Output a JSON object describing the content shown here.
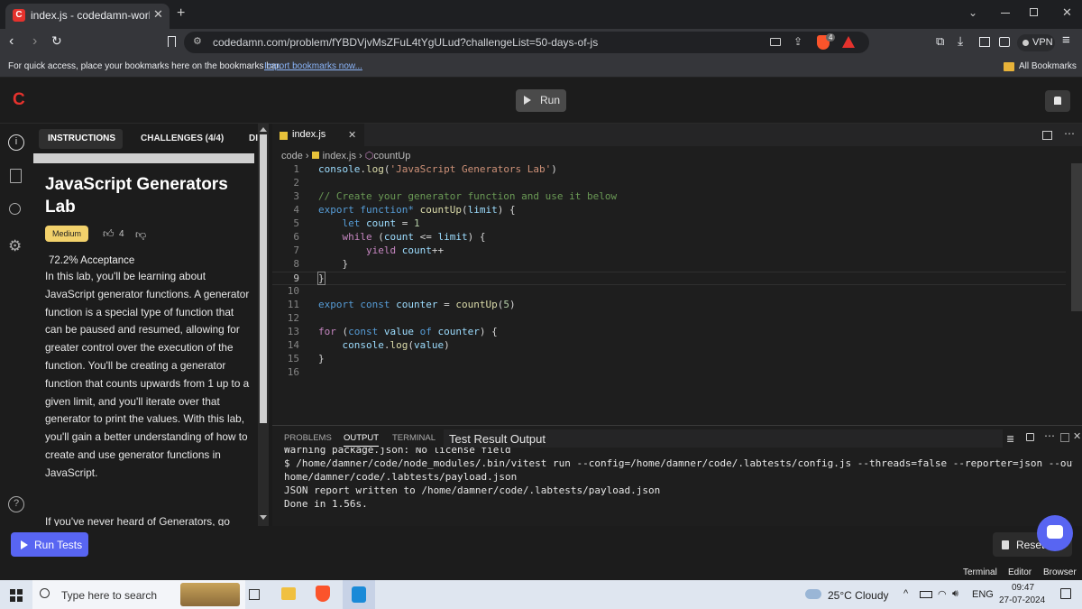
{
  "browser": {
    "tab_title": "index.js - codedamn-workspace",
    "url": "codedamn.com/problem/fYBDVjvMsZFuL4tYgULud?challengeList=50-days-of-js",
    "vpn_label": "VPN",
    "bookmarks_hint": "For quick access, place your bookmarks here on the bookmarks bar.",
    "import_link": "Import bookmarks now...",
    "all_bookmarks": "All Bookmarks",
    "brave_badge": "4"
  },
  "app": {
    "logo": "C",
    "run_label": "Run"
  },
  "instructions": {
    "tabs": [
      "INSTRUCTIONS",
      "CHALLENGES (4/4)",
      "DI"
    ],
    "title": "JavaScript Generators Lab",
    "difficulty": "Medium",
    "likes": "4",
    "acceptance": "72.2% Acceptance",
    "body": "In this lab, you'll be learning about JavaScript generator functions. A generator function is a special type of function that can be paused and resumed, allowing for greater control over the execution of the function. You'll be creating a generator function that counts upwards from 1 up to a given limit, and you'll iterate over that generator to print the values. With this lab, you'll gain a better understanding of how to create and use generator functions in JavaScript.",
    "body2": "If you've never heard of Generators, go"
  },
  "editor": {
    "tab_name": "index.js",
    "breadcrumb": [
      "code",
      "index.js",
      "countUp"
    ]
  },
  "panel": {
    "tabs": [
      "PROBLEMS",
      "OUTPUT",
      "TERMINAL"
    ],
    "active_tab": "OUTPUT",
    "output_channel": "Test Result Output",
    "lines": [
      "Warning package.json: No license field",
      "$ /home/damner/code/node_modules/.bin/vitest run --config=/home/damner/code/.labtests/config.js --threads=false --reporter=json --outputFile=/",
      "home/damner/code/.labtests/payload.json",
      "JSON report written to /home/damner/code/.labtests/payload.json",
      "Done in 1.56s."
    ]
  },
  "footer": {
    "run_tests": "Run Tests",
    "reset_lab": "Reset Lab",
    "modes": [
      "Terminal",
      "Editor",
      "Browser"
    ]
  },
  "taskbar": {
    "search_placeholder": "Type here to search",
    "weather": "25°C  Cloudy",
    "lang": "ENG",
    "time": "09:47",
    "date": "27-07-2024"
  },
  "colors": {
    "accent": "#5865f2",
    "brand_red": "#e5322d",
    "medium_badge": "#f2d16b"
  }
}
